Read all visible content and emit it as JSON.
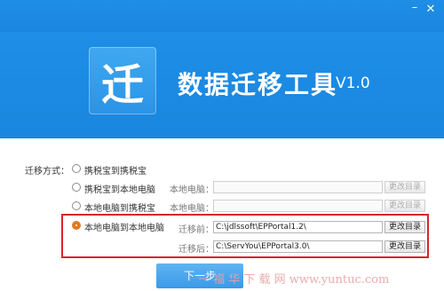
{
  "window": {
    "min_icon": "minimize-icon",
    "close_icon": "close-icon"
  },
  "header": {
    "logo_char": "迁",
    "title": "数据迁移工具",
    "version": "V1.0"
  },
  "form": {
    "mode_label": "迁移方式：",
    "options": [
      {
        "label": "携税宝到携税宝",
        "selected": false
      },
      {
        "label": "携税宝到本地电脑",
        "selected": false,
        "field_label": "本地电脑：",
        "field_value": "",
        "button": "更改目录"
      },
      {
        "label": "本地电脑到携税宝",
        "selected": false,
        "field_label": "本地电脑：",
        "field_value": "",
        "button": "更改目录"
      },
      {
        "label": "本地电脑到本地电脑",
        "selected": true
      }
    ],
    "before": {
      "label": "迁移前：",
      "value": "C:\\jdlssoft\\EPPortal1.2\\",
      "button": "更改目录"
    },
    "after": {
      "label": "迁移后：",
      "value": "C:\\ServYou\\EPPortal3.0\\",
      "button": "更改目录"
    }
  },
  "next_button": "下一步",
  "watermark": "一  福  华  下  载  网  www.yuntuc.com",
  "colors": {
    "brand_blue": "#1e8ee6",
    "selected_radio": "#e07b1f",
    "highlight": "#d9252a"
  }
}
